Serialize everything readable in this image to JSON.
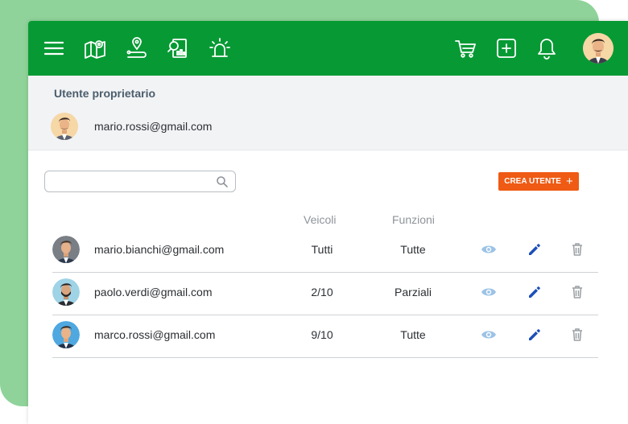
{
  "colors": {
    "topbar": "#079a34",
    "accent_button": "#ef5a14",
    "background_card": "#8fd39a",
    "view_icon": "#9cc3e6",
    "edit_icon": "#1c4fb8",
    "delete_icon": "#9a9fa3"
  },
  "topbar": {
    "left_icons": [
      "menu-icon",
      "map-icon",
      "route-icon",
      "report-search-icon",
      "alarm-siren-icon"
    ],
    "right_icons": [
      "cart-icon",
      "add-square-icon",
      "bell-icon"
    ],
    "avatar": "user-avatar"
  },
  "owner": {
    "title": "Utente proprietario",
    "email": "mario.rossi@gmail.com"
  },
  "search": {
    "placeholder": "",
    "icon": "search-icon"
  },
  "create_button": {
    "label": "CREA UTENTE",
    "icon": "plus-icon"
  },
  "table": {
    "headers": {
      "veicoli": "Veicoli",
      "funzioni": "Funzioni"
    },
    "rows": [
      {
        "email": "mario.bianchi@gmail.com",
        "veicoli": "Tutti",
        "funzioni": "Tutte"
      },
      {
        "email": "paolo.verdi@gmail.com",
        "veicoli": "2/10",
        "funzioni": "Parziali"
      },
      {
        "email": "marco.rossi@gmail.com",
        "veicoli": "9/10",
        "funzioni": "Tutte"
      }
    ],
    "row_actions": [
      "eye-icon",
      "pencil-icon",
      "trash-icon"
    ]
  }
}
